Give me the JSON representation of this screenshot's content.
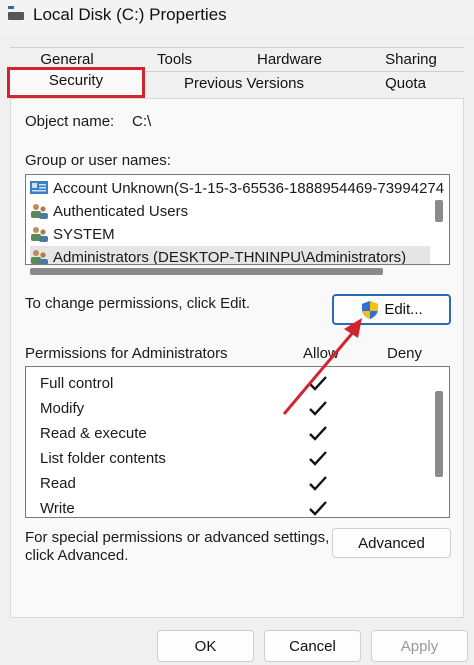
{
  "window": {
    "title": "Local Disk (C:) Properties"
  },
  "tabs_row1": [
    "General",
    "Tools",
    "Hardware",
    "Sharing"
  ],
  "tabs_row2": [
    "Security",
    "Previous Versions",
    "Quota"
  ],
  "object_name": {
    "label": "Object name:",
    "value": "C:\\"
  },
  "group_label": "Group or user names:",
  "users": [
    {
      "name": "Account Unknown(S-1-15-3-65536-1888954469-73994274",
      "icon": "unknown-account-icon"
    },
    {
      "name": "Authenticated Users",
      "icon": "users-icon"
    },
    {
      "name": "SYSTEM",
      "icon": "users-icon"
    },
    {
      "name": "Administrators (DESKTOP-THNINPU\\Administrators)",
      "icon": "users-icon"
    }
  ],
  "change_text": "To change permissions, click Edit.",
  "edit_button": "Edit...",
  "permissions": {
    "header": "Permissions for Administrators",
    "allow": "Allow",
    "deny": "Deny",
    "items": [
      "Full control",
      "Modify",
      "Read & execute",
      "List folder contents",
      "Read",
      "Write"
    ]
  },
  "advanced": {
    "text1": "For special permissions or advanced settings,",
    "text2": "click Advanced.",
    "button": "Advanced"
  },
  "footer": {
    "ok": "OK",
    "cancel": "Cancel",
    "apply": "Apply"
  },
  "colors": {
    "highlight": "#d32330",
    "accent": "#2b6cb0"
  }
}
